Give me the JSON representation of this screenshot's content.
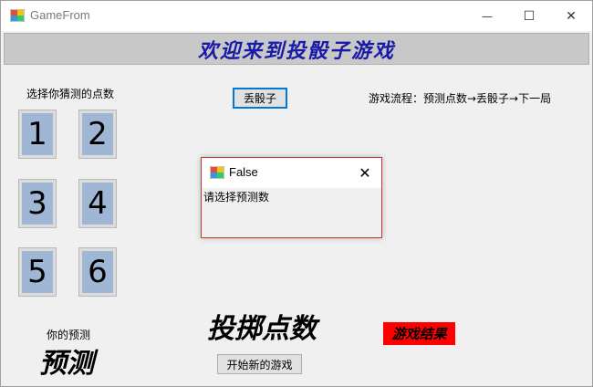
{
  "window": {
    "title": "GameFrom",
    "minimize_glyph": "—",
    "maximize_glyph": "☐",
    "close_glyph": "✕"
  },
  "banner": {
    "text": "欢迎来到投骰子游戏"
  },
  "prediction": {
    "prompt": "选择你猜测的点数",
    "numbers": [
      "1",
      "2",
      "3",
      "4",
      "5",
      "6"
    ],
    "your_prediction_label": "你的预测",
    "prediction_value": "预测"
  },
  "controls": {
    "roll_button": "丢骰子",
    "new_game_button": "开始新的游戏",
    "flow_text": "游戏流程：预测点数→丢骰子→下一局"
  },
  "result": {
    "dice_points": "投掷点数",
    "game_result": "游戏结果",
    "result_color": "#ff0000"
  },
  "dialog": {
    "title": "False",
    "message": "请选择预测数",
    "close_glyph": "✕"
  },
  "colors": {
    "banner_text": "#1a1aa8",
    "number_button": "#9fb6d4",
    "focus_border": "#0078d7"
  }
}
